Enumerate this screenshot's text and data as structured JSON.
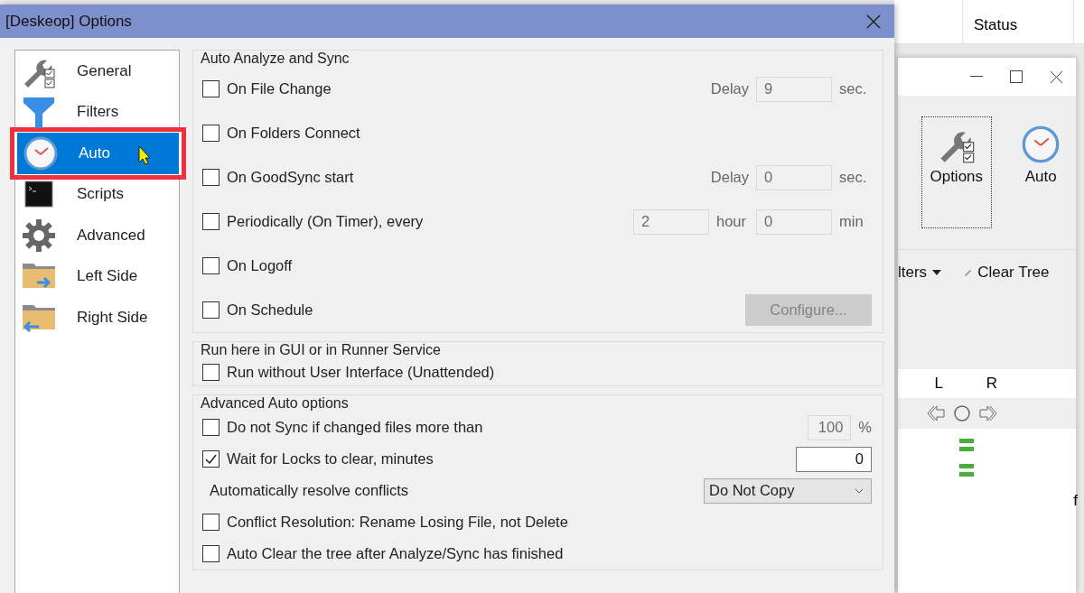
{
  "dialog": {
    "title": "[Deskeop] Options",
    "nav": [
      {
        "label": "General",
        "kind": "wrench-checks",
        "selected": false,
        "outlined": false
      },
      {
        "label": "Filters",
        "kind": "funnel",
        "selected": false,
        "outlined": false
      },
      {
        "label": "Auto",
        "kind": "clock",
        "selected": true,
        "outlined": true
      },
      {
        "label": "Scripts",
        "kind": "terminal",
        "selected": false,
        "outlined": false
      },
      {
        "label": "Advanced",
        "kind": "gear",
        "selected": false,
        "outlined": false
      },
      {
        "label": "Left Side",
        "kind": "folder-right",
        "selected": false,
        "outlined": false
      },
      {
        "label": "Right Side",
        "kind": "folder-left",
        "selected": false,
        "outlined": false
      }
    ],
    "groups": [
      {
        "title": "Auto Analyze and Sync",
        "rows": [
          {
            "label": "On File Change",
            "checked": false,
            "extras": [
              {
                "kind": "text",
                "text": "Delay"
              },
              {
                "kind": "field",
                "value": "9",
                "disabled": true
              },
              {
                "kind": "text",
                "text": "sec."
              }
            ]
          },
          {
            "label": "On Folders Connect",
            "checked": false
          },
          {
            "label": "On GoodSync start",
            "checked": false,
            "extras": [
              {
                "kind": "text",
                "text": "Delay"
              },
              {
                "kind": "field",
                "value": "0",
                "disabled": true
              },
              {
                "kind": "text",
                "text": "sec."
              }
            ]
          },
          {
            "label": "Periodically (On Timer), every",
            "checked": false,
            "extras": [
              {
                "kind": "field",
                "value": "2",
                "disabled": true
              },
              {
                "kind": "text",
                "text": "hour"
              },
              {
                "kind": "field",
                "value": "0",
                "disabled": true
              },
              {
                "kind": "text",
                "text": "min"
              }
            ]
          },
          {
            "label": "On Logoff",
            "checked": false
          },
          {
            "label": "On Schedule",
            "checked": false,
            "extras": [
              {
                "kind": "button",
                "text": "Configure...",
                "disabled": true
              }
            ]
          }
        ]
      },
      {
        "title": "Run here in GUI or in Runner Service",
        "rows": [
          {
            "label": "Run without User Interface (Unattended)",
            "checked": false
          }
        ]
      },
      {
        "title": "Advanced Auto options",
        "rows": [
          {
            "label": "Do not Sync if changed files more than",
            "checked": false,
            "extras": [
              {
                "kind": "small-field",
                "value": "100",
                "disabled": true
              },
              {
                "kind": "text",
                "text": "%"
              }
            ]
          },
          {
            "label": "Wait for Locks to clear, minutes",
            "checked": true,
            "extras": [
              {
                "kind": "field",
                "value": "0",
                "disabled": false
              }
            ]
          },
          {
            "label": "Automatically resolve conflicts",
            "extras": [
              {
                "kind": "select",
                "value": "Do Not Copy"
              }
            ]
          },
          {
            "label": "Conflict Resolution: Rename Losing File, not Delete",
            "checked": false
          },
          {
            "label": "Auto Clear the tree after Analyze/Sync has finished",
            "checked": false
          }
        ]
      }
    ]
  },
  "background": {
    "status_header": "Status",
    "toolbar": [
      {
        "label": "Options",
        "kind": "wrench-checks",
        "focused": true
      },
      {
        "label": "Auto",
        "kind": "clock",
        "focused": false
      }
    ],
    "filters_label": "lters",
    "clear_tree": "Clear Tree",
    "columns": [
      "L",
      "R"
    ],
    "sync_marks": [
      {
        "kind": "equal"
      },
      {
        "kind": "equal"
      }
    ],
    "edge_text": "f"
  }
}
